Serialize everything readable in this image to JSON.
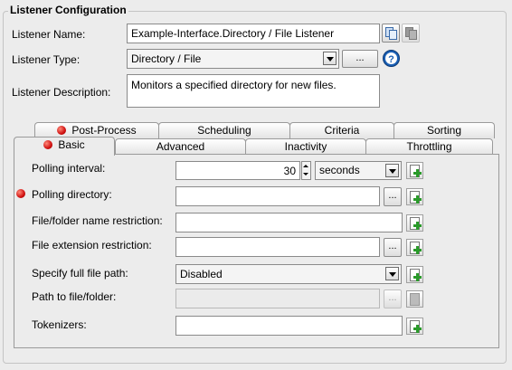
{
  "group": {
    "title": "Listener Configuration"
  },
  "listener": {
    "name_label": "Listener Name:",
    "name_value": "Example-Interface.Directory / File Listener",
    "type_label": "Listener Type:",
    "type_value": "Directory / File",
    "type_browse": "...",
    "description_label": "Listener Description:",
    "description_value": "Monitors a specified directory for new files."
  },
  "tabs": {
    "row1": [
      "Post-Process",
      "Scheduling",
      "Criteria",
      "Sorting"
    ],
    "row2": [
      "Basic",
      "Advanced",
      "Inactivity",
      "Throttling"
    ],
    "active": "Basic"
  },
  "basic": {
    "polling_interval_label": "Polling interval:",
    "polling_interval_value": "30",
    "polling_interval_unit": "seconds",
    "polling_directory_label": "Polling directory:",
    "polling_directory_value": "",
    "name_restriction_label": "File/folder name restriction:",
    "name_restriction_value": "",
    "extension_restriction_label": "File extension restriction:",
    "extension_restriction_value": "",
    "full_path_label": "Specify full file path:",
    "full_path_value": "Disabled",
    "path_label": "Path to file/folder:",
    "path_value": "",
    "tokenizers_label": "Tokenizers:",
    "tokenizers_value": "",
    "browse": "..."
  },
  "colors": {
    "required_dot": "#d01010",
    "help_icon": "#1a5fb4",
    "add_plus": "#2a9a2a"
  },
  "icons": [
    "copy-icon",
    "paste-icon",
    "help-icon",
    "required-indicator-icon",
    "add-variable-icon"
  ]
}
